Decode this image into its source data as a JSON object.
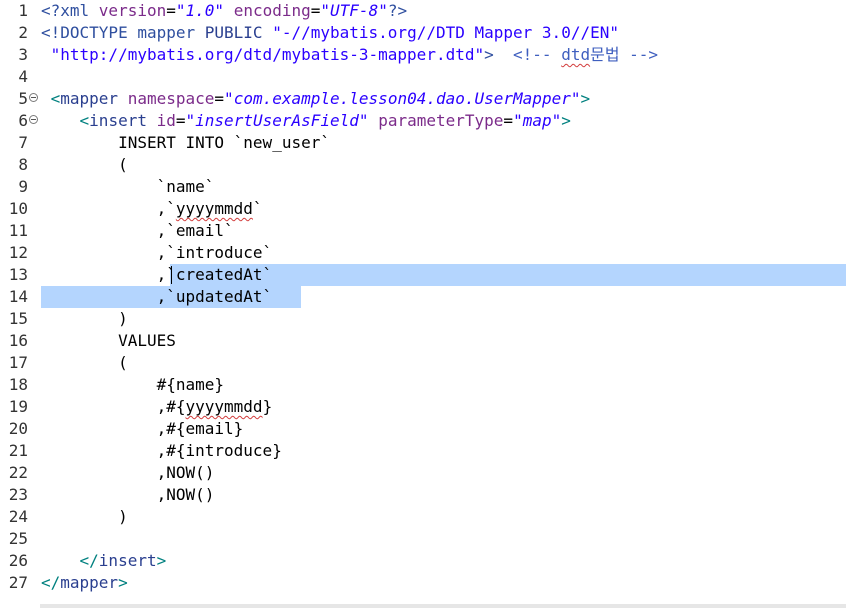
{
  "editor": {
    "lines": [
      {
        "n": "1",
        "fold": false,
        "tokens": [
          {
            "t": "<?",
            "c": "c-pi"
          },
          {
            "t": "xml ",
            "c": "c-pi"
          },
          {
            "t": "version",
            "c": "c-attr"
          },
          {
            "t": "=",
            "c": "c-plain"
          },
          {
            "t": "\"",
            "c": "c-str"
          },
          {
            "t": "1.0",
            "c": "c-val"
          },
          {
            "t": "\" ",
            "c": "c-str"
          },
          {
            "t": "encoding",
            "c": "c-attr"
          },
          {
            "t": "=",
            "c": "c-plain"
          },
          {
            "t": "\"",
            "c": "c-str"
          },
          {
            "t": "UTF-8",
            "c": "c-val"
          },
          {
            "t": "\"",
            "c": "c-str"
          },
          {
            "t": "?>",
            "c": "c-pi"
          }
        ]
      },
      {
        "n": "2",
        "fold": false,
        "tokens": [
          {
            "t": "<!DOCTYPE mapper ",
            "c": "c-doctype"
          },
          {
            "t": "PUBLIC ",
            "c": "c-tag"
          },
          {
            "t": "\"-//mybatis.org//DTD Mapper 3.0//EN\"",
            "c": "c-str"
          }
        ]
      },
      {
        "n": "3",
        "fold": false,
        "tokens": [
          {
            "t": " \"http://mybatis.org/dtd/mybatis-3-mapper.dtd\"",
            "c": "c-str"
          },
          {
            "t": ">  ",
            "c": "c-doctype"
          },
          {
            "t": "<!-- ",
            "c": "c-comment"
          },
          {
            "t": "dtd",
            "c": "c-comment",
            "wavy": true
          },
          {
            "t": "문법 -->",
            "c": "c-comment"
          }
        ]
      },
      {
        "n": "4",
        "fold": false,
        "tokens": []
      },
      {
        "n": "5",
        "fold": true,
        "tokens": [
          {
            "t": " <",
            "c": "c-bracket"
          },
          {
            "t": "mapper ",
            "c": "c-tag"
          },
          {
            "t": "namespace",
            "c": "c-attr"
          },
          {
            "t": "=",
            "c": "c-plain"
          },
          {
            "t": "\"",
            "c": "c-str"
          },
          {
            "t": "com.example.lesson04.dao.UserMapper",
            "c": "c-val"
          },
          {
            "t": "\"",
            "c": "c-str"
          },
          {
            "t": ">",
            "c": "c-bracket"
          }
        ]
      },
      {
        "n": "6",
        "fold": true,
        "tokens": [
          {
            "t": "    <",
            "c": "c-bracket"
          },
          {
            "t": "insert ",
            "c": "c-tag"
          },
          {
            "t": "id",
            "c": "c-attr"
          },
          {
            "t": "=",
            "c": "c-plain"
          },
          {
            "t": "\"",
            "c": "c-str"
          },
          {
            "t": "insertUserAsField",
            "c": "c-val"
          },
          {
            "t": "\" ",
            "c": "c-str"
          },
          {
            "t": "parameterType",
            "c": "c-attr"
          },
          {
            "t": "=",
            "c": "c-plain"
          },
          {
            "t": "\"",
            "c": "c-str"
          },
          {
            "t": "map",
            "c": "c-val"
          },
          {
            "t": "\"",
            "c": "c-str"
          },
          {
            "t": ">",
            "c": "c-bracket"
          }
        ]
      },
      {
        "n": "7",
        "fold": false,
        "tokens": [
          {
            "t": "        INSERT INTO `new_user`",
            "c": "c-plain"
          }
        ]
      },
      {
        "n": "8",
        "fold": false,
        "tokens": [
          {
            "t": "        (",
            "c": "c-plain"
          }
        ]
      },
      {
        "n": "9",
        "fold": false,
        "tokens": [
          {
            "t": "            `name`",
            "c": "c-plain"
          }
        ]
      },
      {
        "n": "10",
        "fold": false,
        "tokens": [
          {
            "t": "            ,`",
            "c": "c-plain"
          },
          {
            "t": "yyyymmdd",
            "c": "c-plain",
            "wavy": true
          },
          {
            "t": "`",
            "c": "c-plain"
          }
        ]
      },
      {
        "n": "11",
        "fold": false,
        "tokens": [
          {
            "t": "            ,`email`",
            "c": "c-plain"
          }
        ]
      },
      {
        "n": "12",
        "fold": false,
        "tokens": [
          {
            "t": "            ,`introduce`",
            "c": "c-plain"
          }
        ]
      },
      {
        "n": "13",
        "fold": false,
        "sel": "sel-13",
        "caret": true,
        "tokens": [
          {
            "t": "            ,`createdAt`",
            "c": "c-plain"
          }
        ]
      },
      {
        "n": "14",
        "fold": false,
        "sel": "sel-14",
        "tokens": [
          {
            "t": "            ,`updatedAt`",
            "c": "c-plain"
          }
        ]
      },
      {
        "n": "15",
        "fold": false,
        "tokens": [
          {
            "t": "        )",
            "c": "c-plain"
          }
        ]
      },
      {
        "n": "16",
        "fold": false,
        "tokens": [
          {
            "t": "        VALUES",
            "c": "c-plain"
          }
        ]
      },
      {
        "n": "17",
        "fold": false,
        "tokens": [
          {
            "t": "        (",
            "c": "c-plain"
          }
        ]
      },
      {
        "n": "18",
        "fold": false,
        "tokens": [
          {
            "t": "            #{name}",
            "c": "c-plain"
          }
        ]
      },
      {
        "n": "19",
        "fold": false,
        "tokens": [
          {
            "t": "            ,#{",
            "c": "c-plain"
          },
          {
            "t": "yyyymmdd",
            "c": "c-plain",
            "wavy": true
          },
          {
            "t": "}",
            "c": "c-plain"
          }
        ]
      },
      {
        "n": "20",
        "fold": false,
        "tokens": [
          {
            "t": "            ,#{email}",
            "c": "c-plain"
          }
        ]
      },
      {
        "n": "21",
        "fold": false,
        "tokens": [
          {
            "t": "            ,#{introduce}",
            "c": "c-plain"
          }
        ]
      },
      {
        "n": "22",
        "fold": false,
        "tokens": [
          {
            "t": "            ,NOW()",
            "c": "c-plain"
          }
        ]
      },
      {
        "n": "23",
        "fold": false,
        "tokens": [
          {
            "t": "            ,NOW()",
            "c": "c-plain"
          }
        ]
      },
      {
        "n": "24",
        "fold": false,
        "tokens": [
          {
            "t": "        )",
            "c": "c-plain"
          }
        ]
      },
      {
        "n": "25",
        "fold": false,
        "tokens": []
      },
      {
        "n": "26",
        "fold": false,
        "tokens": [
          {
            "t": "    </",
            "c": "c-bracket"
          },
          {
            "t": "insert",
            "c": "c-tag"
          },
          {
            "t": ">",
            "c": "c-bracket"
          }
        ]
      },
      {
        "n": "27",
        "fold": false,
        "tokens": [
          {
            "t": "</",
            "c": "c-bracket"
          },
          {
            "t": "mapper",
            "c": "c-tag"
          },
          {
            "t": ">",
            "c": "c-bracket"
          }
        ]
      }
    ]
  }
}
